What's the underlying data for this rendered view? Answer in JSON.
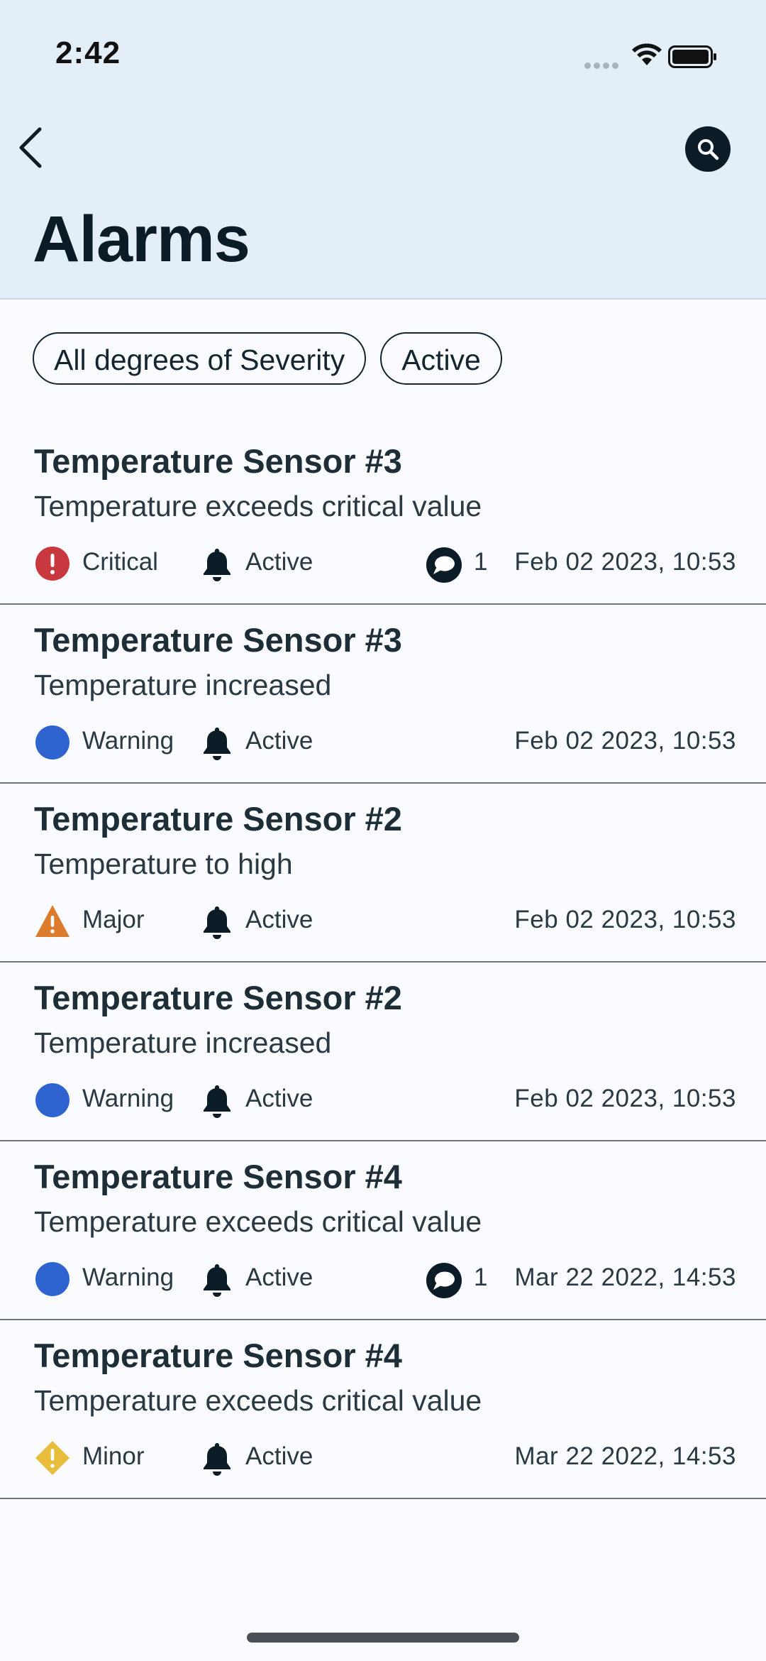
{
  "status_bar": {
    "time": "2:42"
  },
  "header": {
    "title": "Alarms"
  },
  "filters": [
    {
      "label": "All degrees of Severity"
    },
    {
      "label": "Active"
    }
  ],
  "colors": {
    "critical": "#c9373f",
    "warning": "#2f63cf",
    "major": "#db7b2b",
    "minor": "#e9bd3c",
    "dark": "#0c1c26"
  },
  "alarms": [
    {
      "title": "Temperature Sensor #3",
      "description": "Temperature exceeds critical value",
      "severity": "Critical",
      "severity_icon": "critical-icon",
      "status": "Active",
      "comments": "1",
      "timestamp": "Feb 02 2023, 10:53"
    },
    {
      "title": "Temperature Sensor #3",
      "description": "Temperature increased",
      "severity": "Warning",
      "severity_icon": "warning-icon",
      "status": "Active",
      "comments": "",
      "timestamp": "Feb 02 2023, 10:53"
    },
    {
      "title": "Temperature Sensor #2",
      "description": "Temperature to high",
      "severity": "Major",
      "severity_icon": "major-icon",
      "status": "Active",
      "comments": "",
      "timestamp": "Feb 02 2023, 10:53"
    },
    {
      "title": "Temperature Sensor #2",
      "description": "Temperature increased",
      "severity": "Warning",
      "severity_icon": "warning-icon",
      "status": "Active",
      "comments": "",
      "timestamp": "Feb 02 2023, 10:53"
    },
    {
      "title": "Temperature Sensor #4",
      "description": "Temperature exceeds critical value",
      "severity": "Warning",
      "severity_icon": "warning-icon",
      "status": "Active",
      "comments": "1",
      "timestamp": "Mar 22 2022, 14:53"
    },
    {
      "title": "Temperature Sensor #4",
      "description": "Temperature exceeds critical value",
      "severity": "Minor",
      "severity_icon": "minor-icon",
      "status": "Active",
      "comments": "",
      "timestamp": "Mar 22 2022, 14:53"
    }
  ]
}
